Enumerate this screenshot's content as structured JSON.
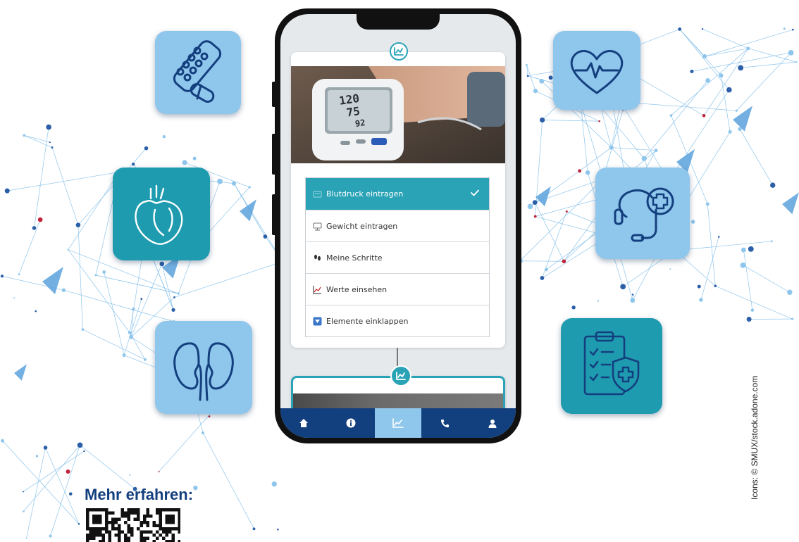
{
  "phone": {
    "menu": {
      "items": [
        {
          "label": "Blutdruck eintragen",
          "icon": "blood-pressure-icon",
          "active": true
        },
        {
          "label": "Gewicht eintragen",
          "icon": "scale-icon",
          "active": false
        },
        {
          "label": "Meine Schritte",
          "icon": "footsteps-icon",
          "active": false
        },
        {
          "label": "Werte einsehen",
          "icon": "chart-icon",
          "active": false
        },
        {
          "label": "Elemente einklappen",
          "icon": "collapse-icon",
          "active": false
        }
      ],
      "active_check_icon": "checkmark-icon"
    },
    "photo": {
      "monitor_readings": [
        "120",
        "75",
        "92"
      ]
    },
    "tabbar": {
      "tabs": [
        {
          "icon": "home-icon"
        },
        {
          "icon": "info-icon"
        },
        {
          "icon": "chart-icon",
          "active": true
        },
        {
          "icon": "phone-icon"
        },
        {
          "icon": "user-icon"
        }
      ]
    }
  },
  "tiles": [
    {
      "icon": "pills-icon",
      "color": "#8fc6ec"
    },
    {
      "icon": "heartbeat-icon",
      "color": "#8fc6ec"
    },
    {
      "icon": "anatomical-heart-icon",
      "color": "#1f9bb0"
    },
    {
      "icon": "stethoscope-plus-icon",
      "color": "#8fc6ec"
    },
    {
      "icon": "kidneys-icon",
      "color": "#8fc6ec"
    },
    {
      "icon": "clipboard-shield-icon",
      "color": "#1f9bb0"
    }
  ],
  "footer": {
    "heading": "Mehr erfahren:",
    "qr_icon": "qr-code-icon"
  },
  "credit": "Icons: © SMUX/stock.adone.com",
  "colors": {
    "brand_navy": "#143f7e",
    "teal": "#2aa3b6",
    "light_blue": "#8fc6ec",
    "tabbar": "#123f7d"
  }
}
